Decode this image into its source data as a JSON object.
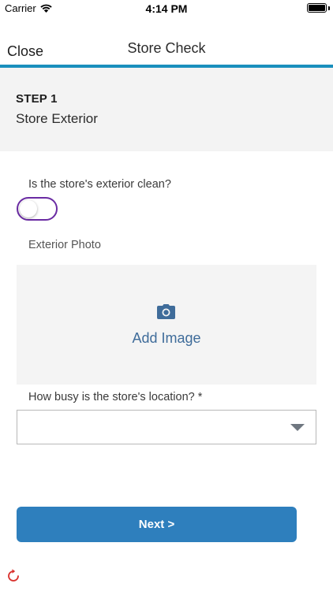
{
  "status_bar": {
    "carrier": "Carrier",
    "time": "4:14 PM",
    "wifi_icon": "wifi-icon",
    "battery_icon": "battery-icon",
    "battery_level": 1.0
  },
  "nav": {
    "close_label": "Close",
    "title": "Store Check",
    "accent_color": "#1a8fbd"
  },
  "step": {
    "label": "STEP 1",
    "name": "Store Exterior"
  },
  "questions": {
    "exterior_clean": {
      "label": "Is the store's exterior clean?",
      "value": false,
      "toggle_border_color": "#6a2ba3"
    },
    "exterior_photo": {
      "label": "Exterior Photo",
      "action_label": "Add Image",
      "icon": "camera-icon"
    },
    "location_busy": {
      "label": "How busy is the store's location? *",
      "value": "",
      "icon": "chevron-down-icon"
    }
  },
  "actions": {
    "next_label": "Next >",
    "next_color": "#2e7fbd",
    "refresh_icon": "refresh-icon"
  }
}
